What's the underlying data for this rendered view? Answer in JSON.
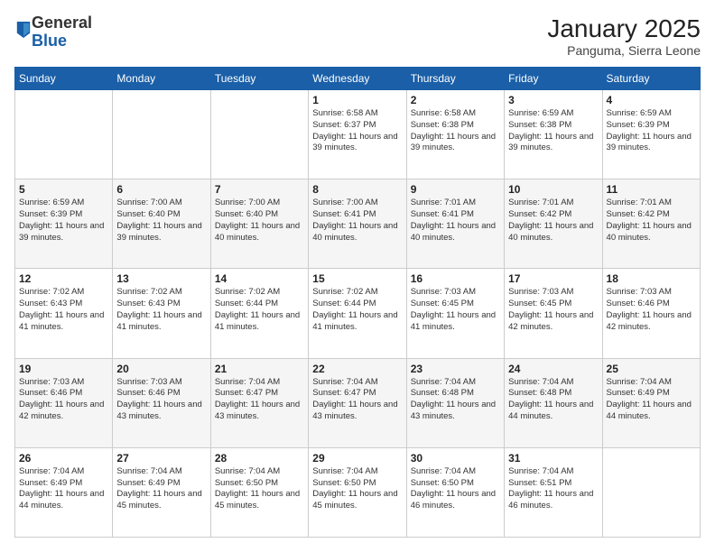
{
  "header": {
    "logo": {
      "general": "General",
      "blue": "Blue"
    },
    "title": "January 2025",
    "subtitle": "Panguma, Sierra Leone"
  },
  "weekdays": [
    "Sunday",
    "Monday",
    "Tuesday",
    "Wednesday",
    "Thursday",
    "Friday",
    "Saturday"
  ],
  "weeks": [
    [
      {
        "day": null,
        "info": null
      },
      {
        "day": null,
        "info": null
      },
      {
        "day": null,
        "info": null
      },
      {
        "day": "1",
        "sunrise": "6:58 AM",
        "sunset": "6:37 PM",
        "daylight": "11 hours and 39 minutes."
      },
      {
        "day": "2",
        "sunrise": "6:58 AM",
        "sunset": "6:38 PM",
        "daylight": "11 hours and 39 minutes."
      },
      {
        "day": "3",
        "sunrise": "6:59 AM",
        "sunset": "6:38 PM",
        "daylight": "11 hours and 39 minutes."
      },
      {
        "day": "4",
        "sunrise": "6:59 AM",
        "sunset": "6:39 PM",
        "daylight": "11 hours and 39 minutes."
      }
    ],
    [
      {
        "day": "5",
        "sunrise": "6:59 AM",
        "sunset": "6:39 PM",
        "daylight": "11 hours and 39 minutes."
      },
      {
        "day": "6",
        "sunrise": "7:00 AM",
        "sunset": "6:40 PM",
        "daylight": "11 hours and 39 minutes."
      },
      {
        "day": "7",
        "sunrise": "7:00 AM",
        "sunset": "6:40 PM",
        "daylight": "11 hours and 40 minutes."
      },
      {
        "day": "8",
        "sunrise": "7:00 AM",
        "sunset": "6:41 PM",
        "daylight": "11 hours and 40 minutes."
      },
      {
        "day": "9",
        "sunrise": "7:01 AM",
        "sunset": "6:41 PM",
        "daylight": "11 hours and 40 minutes."
      },
      {
        "day": "10",
        "sunrise": "7:01 AM",
        "sunset": "6:42 PM",
        "daylight": "11 hours and 40 minutes."
      },
      {
        "day": "11",
        "sunrise": "7:01 AM",
        "sunset": "6:42 PM",
        "daylight": "11 hours and 40 minutes."
      }
    ],
    [
      {
        "day": "12",
        "sunrise": "7:02 AM",
        "sunset": "6:43 PM",
        "daylight": "11 hours and 41 minutes."
      },
      {
        "day": "13",
        "sunrise": "7:02 AM",
        "sunset": "6:43 PM",
        "daylight": "11 hours and 41 minutes."
      },
      {
        "day": "14",
        "sunrise": "7:02 AM",
        "sunset": "6:44 PM",
        "daylight": "11 hours and 41 minutes."
      },
      {
        "day": "15",
        "sunrise": "7:02 AM",
        "sunset": "6:44 PM",
        "daylight": "11 hours and 41 minutes."
      },
      {
        "day": "16",
        "sunrise": "7:03 AM",
        "sunset": "6:45 PM",
        "daylight": "11 hours and 41 minutes."
      },
      {
        "day": "17",
        "sunrise": "7:03 AM",
        "sunset": "6:45 PM",
        "daylight": "11 hours and 42 minutes."
      },
      {
        "day": "18",
        "sunrise": "7:03 AM",
        "sunset": "6:46 PM",
        "daylight": "11 hours and 42 minutes."
      }
    ],
    [
      {
        "day": "19",
        "sunrise": "7:03 AM",
        "sunset": "6:46 PM",
        "daylight": "11 hours and 42 minutes."
      },
      {
        "day": "20",
        "sunrise": "7:03 AM",
        "sunset": "6:46 PM",
        "daylight": "11 hours and 43 minutes."
      },
      {
        "day": "21",
        "sunrise": "7:04 AM",
        "sunset": "6:47 PM",
        "daylight": "11 hours and 43 minutes."
      },
      {
        "day": "22",
        "sunrise": "7:04 AM",
        "sunset": "6:47 PM",
        "daylight": "11 hours and 43 minutes."
      },
      {
        "day": "23",
        "sunrise": "7:04 AM",
        "sunset": "6:48 PM",
        "daylight": "11 hours and 43 minutes."
      },
      {
        "day": "24",
        "sunrise": "7:04 AM",
        "sunset": "6:48 PM",
        "daylight": "11 hours and 44 minutes."
      },
      {
        "day": "25",
        "sunrise": "7:04 AM",
        "sunset": "6:49 PM",
        "daylight": "11 hours and 44 minutes."
      }
    ],
    [
      {
        "day": "26",
        "sunrise": "7:04 AM",
        "sunset": "6:49 PM",
        "daylight": "11 hours and 44 minutes."
      },
      {
        "day": "27",
        "sunrise": "7:04 AM",
        "sunset": "6:49 PM",
        "daylight": "11 hours and 45 minutes."
      },
      {
        "day": "28",
        "sunrise": "7:04 AM",
        "sunset": "6:50 PM",
        "daylight": "11 hours and 45 minutes."
      },
      {
        "day": "29",
        "sunrise": "7:04 AM",
        "sunset": "6:50 PM",
        "daylight": "11 hours and 45 minutes."
      },
      {
        "day": "30",
        "sunrise": "7:04 AM",
        "sunset": "6:50 PM",
        "daylight": "11 hours and 46 minutes."
      },
      {
        "day": "31",
        "sunrise": "7:04 AM",
        "sunset": "6:51 PM",
        "daylight": "11 hours and 46 minutes."
      },
      {
        "day": null,
        "info": null
      }
    ]
  ]
}
